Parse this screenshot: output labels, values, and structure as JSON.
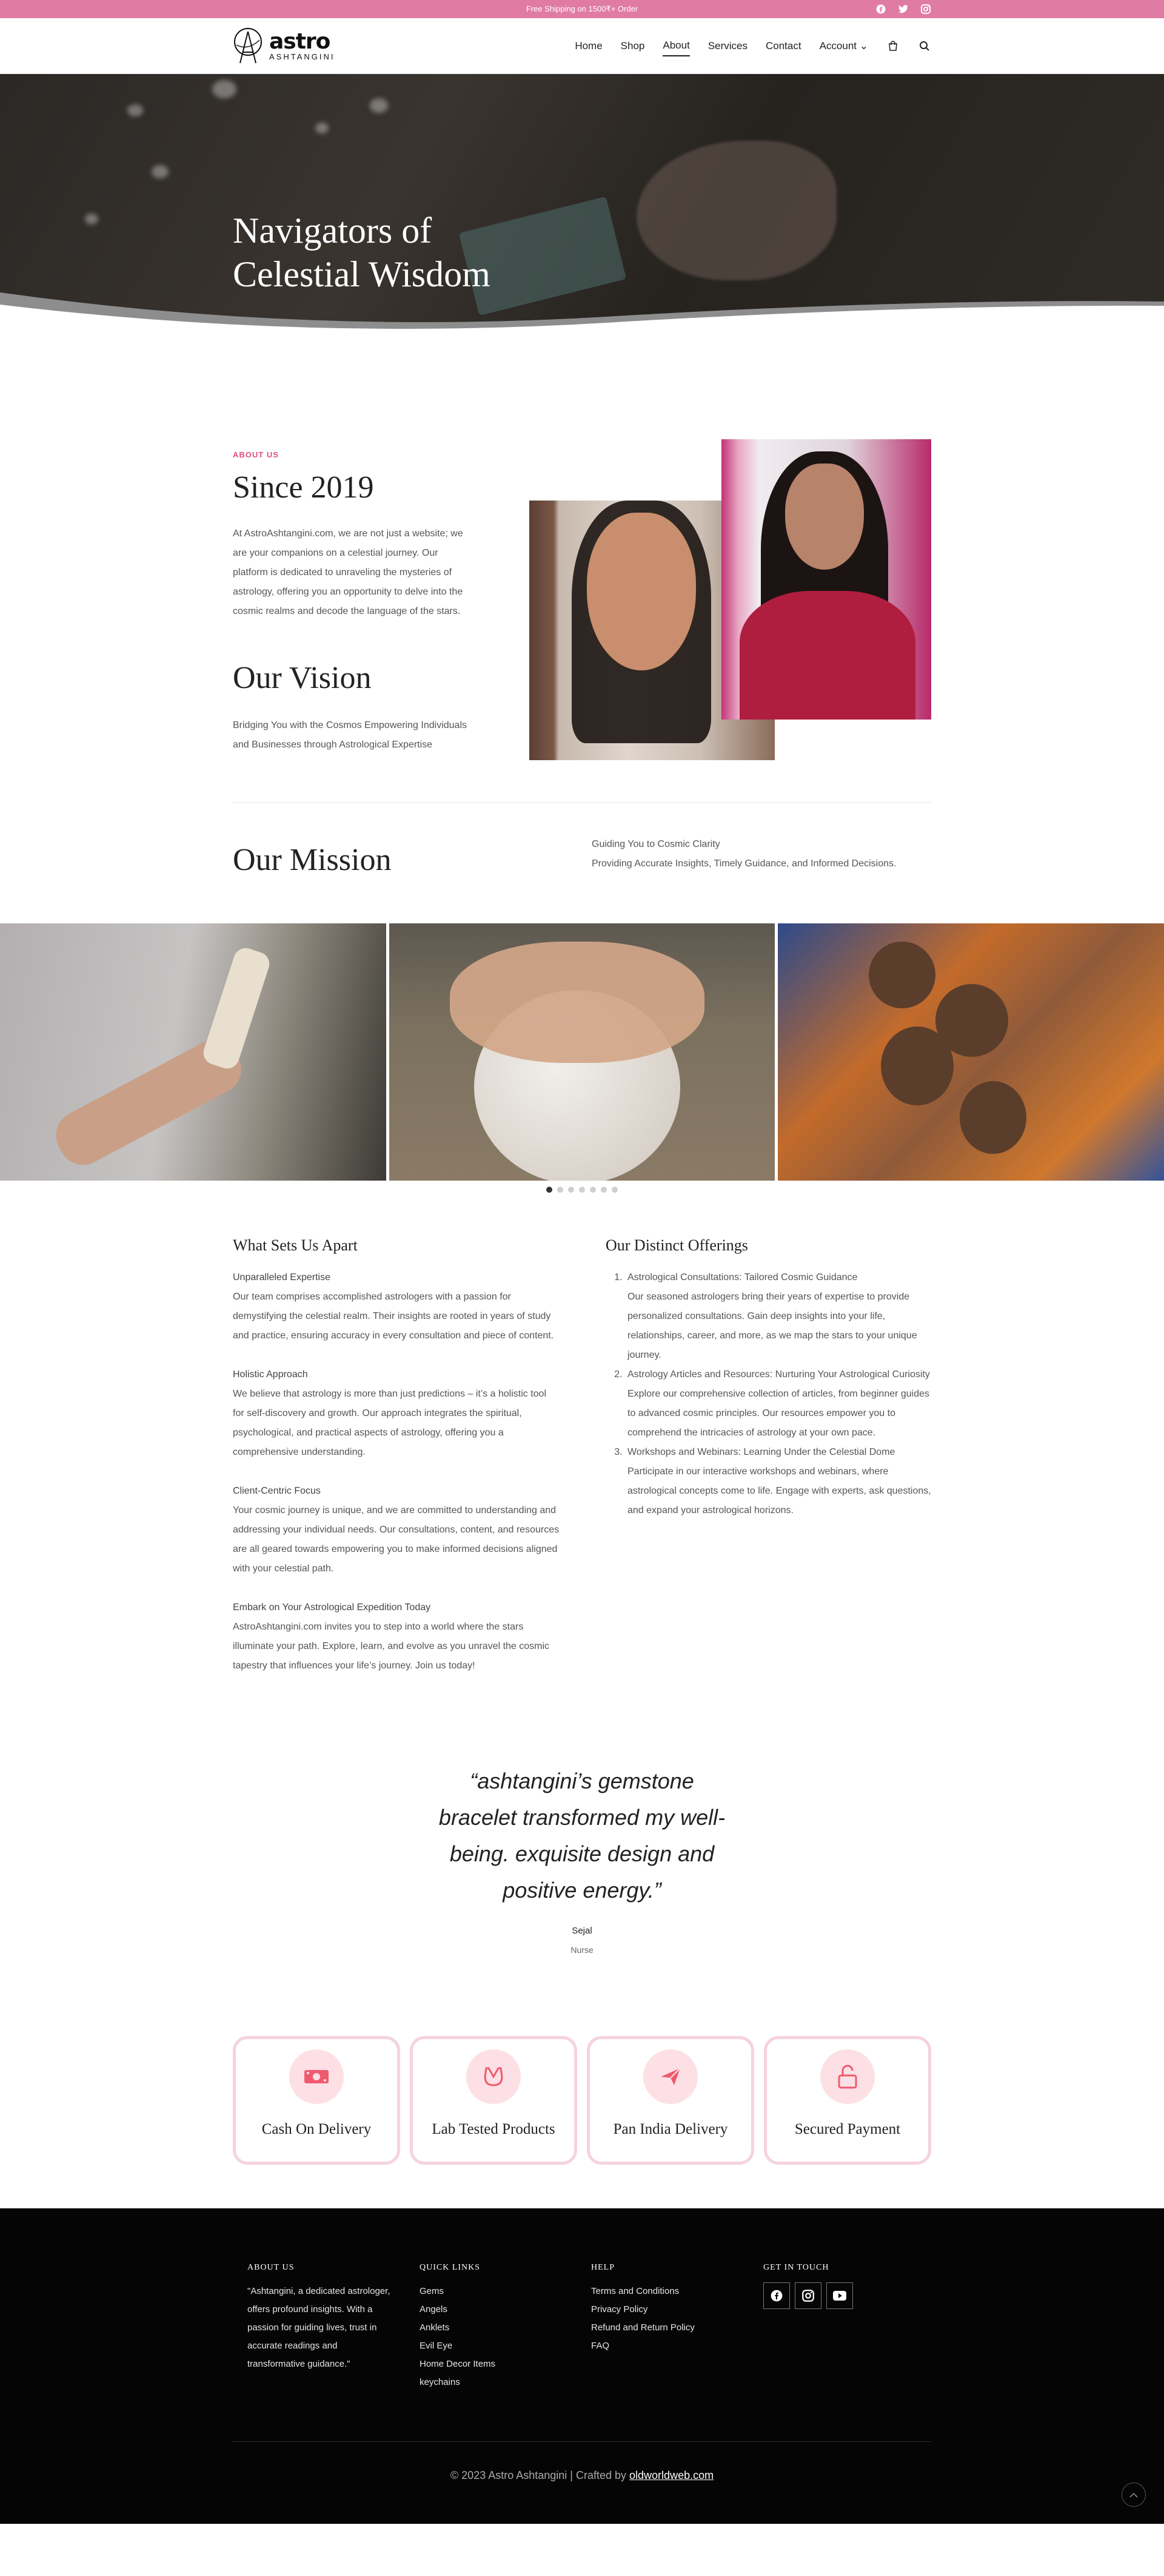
{
  "topbar": {
    "message": "Free Shipping on 1500₹+ Order",
    "socials": [
      "facebook-icon",
      "twitter-icon",
      "instagram-icon"
    ]
  },
  "header": {
    "logo_main": "astro",
    "logo_sub": "ASHTANGINI",
    "nav": [
      {
        "label": "Home"
      },
      {
        "label": "Shop"
      },
      {
        "label": "About",
        "active": true
      },
      {
        "label": "Services"
      },
      {
        "label": "Contact"
      },
      {
        "label": "Account ⌄"
      }
    ]
  },
  "hero": {
    "title_line1": "Navigators of",
    "title_line2": "Celestial Wisdom"
  },
  "about": {
    "eyebrow": "ABOUT US",
    "heading": "Since 2019",
    "body": "At AstroAshtangini.com, we are not just a website; we are your companions on a celestial journey. Our platform is dedicated to unraveling the mysteries of astrology, offering you an opportunity to delve into the cosmic realms and decode the language of the stars.",
    "vision_heading": "Our Vision",
    "vision_body": "Bridging You with the Cosmos Empowering Individuals and Businesses through Astrological Expertise"
  },
  "mission": {
    "heading": "Our Mission",
    "line1": "Guiding You to Cosmic Clarity",
    "line2": "Providing Accurate Insights, Timely Guidance, and Informed Decisions."
  },
  "gallery": {
    "dots": 7,
    "active_dot": 0
  },
  "apart": {
    "heading": "What Sets Us Apart",
    "blocks": [
      {
        "head": "Unparalleled Expertise",
        "body": "Our team comprises accomplished astrologers with a passion for demystifying the celestial realm. Their insights are rooted in years of study and practice, ensuring accuracy in every consultation and piece of content."
      },
      {
        "head": "Holistic Approach",
        "body": "We believe that astrology is more than just predictions – it’s a holistic tool for self-discovery and growth. Our approach integrates the spiritual, psychological, and practical aspects of astrology, offering you a comprehensive understanding."
      },
      {
        "head": "Client-Centric Focus",
        "body": "Your cosmic journey is unique, and we are committed to understanding and addressing your individual needs. Our consultations, content, and resources are all geared towards empowering you to make informed decisions aligned with your celestial path."
      },
      {
        "head": "Embark on Your Astrological Expedition Today",
        "body": "AstroAshtangini.com invites you to step into a world where the stars illuminate your path. Explore, learn, and evolve as you unravel the cosmic tapestry that influences your life’s journey. Join us today!"
      }
    ]
  },
  "offerings": {
    "heading": "Our Distinct Offerings",
    "items": [
      {
        "head": "Astrological Consultations: Tailored Cosmic Guidance",
        "body": "Our seasoned astrologers bring their years of expertise to provide personalized consultations. Gain deep insights into your life, relationships, career, and more, as we map the stars to your unique journey."
      },
      {
        "head": "Astrology Articles and Resources: Nurturing Your Astrological Curiosity",
        "body": "Explore our comprehensive collection of articles, from beginner guides to advanced cosmic principles. Our resources empower you to comprehend the intricacies of astrology at your own pace."
      },
      {
        "head": "Workshops and Webinars: Learning Under the Celestial Dome",
        "body": "Participate in our interactive workshops and webinars, where astrological concepts come to life. Engage with experts, ask questions, and expand your astrological horizons."
      }
    ]
  },
  "testimonial": {
    "quote": "“ashtangini’s gemstone bracelet transformed my well-being. exquisite design and positive energy.”",
    "name": "Sejal",
    "role": "Nurse"
  },
  "features": [
    {
      "label": "Cash On Delivery",
      "icon": "cash-icon"
    },
    {
      "label": "Lab Tested Products",
      "icon": "lab-test-icon"
    },
    {
      "label": "Pan India Delivery",
      "icon": "paper-plane-icon"
    },
    {
      "label": "Secured Payment",
      "icon": "lock-icon"
    }
  ],
  "footer": {
    "about_heading": "ABOUT US",
    "about_text": "\"Ashtangini, a dedicated astrologer, offers profound insights. With a passion for guiding lives, trust in accurate readings and transformative guidance.\"",
    "links_heading": "QUICK LINKS",
    "links": [
      "Gems",
      "Angels",
      "Anklets",
      "Evil Eye",
      "Home Decor Items",
      "keychains"
    ],
    "help_heading": "HELP",
    "help": [
      "Terms and Conditions",
      "Privacy Policy",
      "Refund and Return Policy",
      "FAQ"
    ],
    "touch_heading": "GET IN TOUCH",
    "copyright": "© 2023 Astro Ashtangini | Crafted by ",
    "credit": "oldworldweb.com"
  },
  "colors": {
    "accent_pink": "#e07ca4",
    "eyebrow_pink": "#e0507f",
    "feature_border": "#f5d3dd",
    "feature_circle": "#fde0e5",
    "footer_bg": "#050505"
  }
}
